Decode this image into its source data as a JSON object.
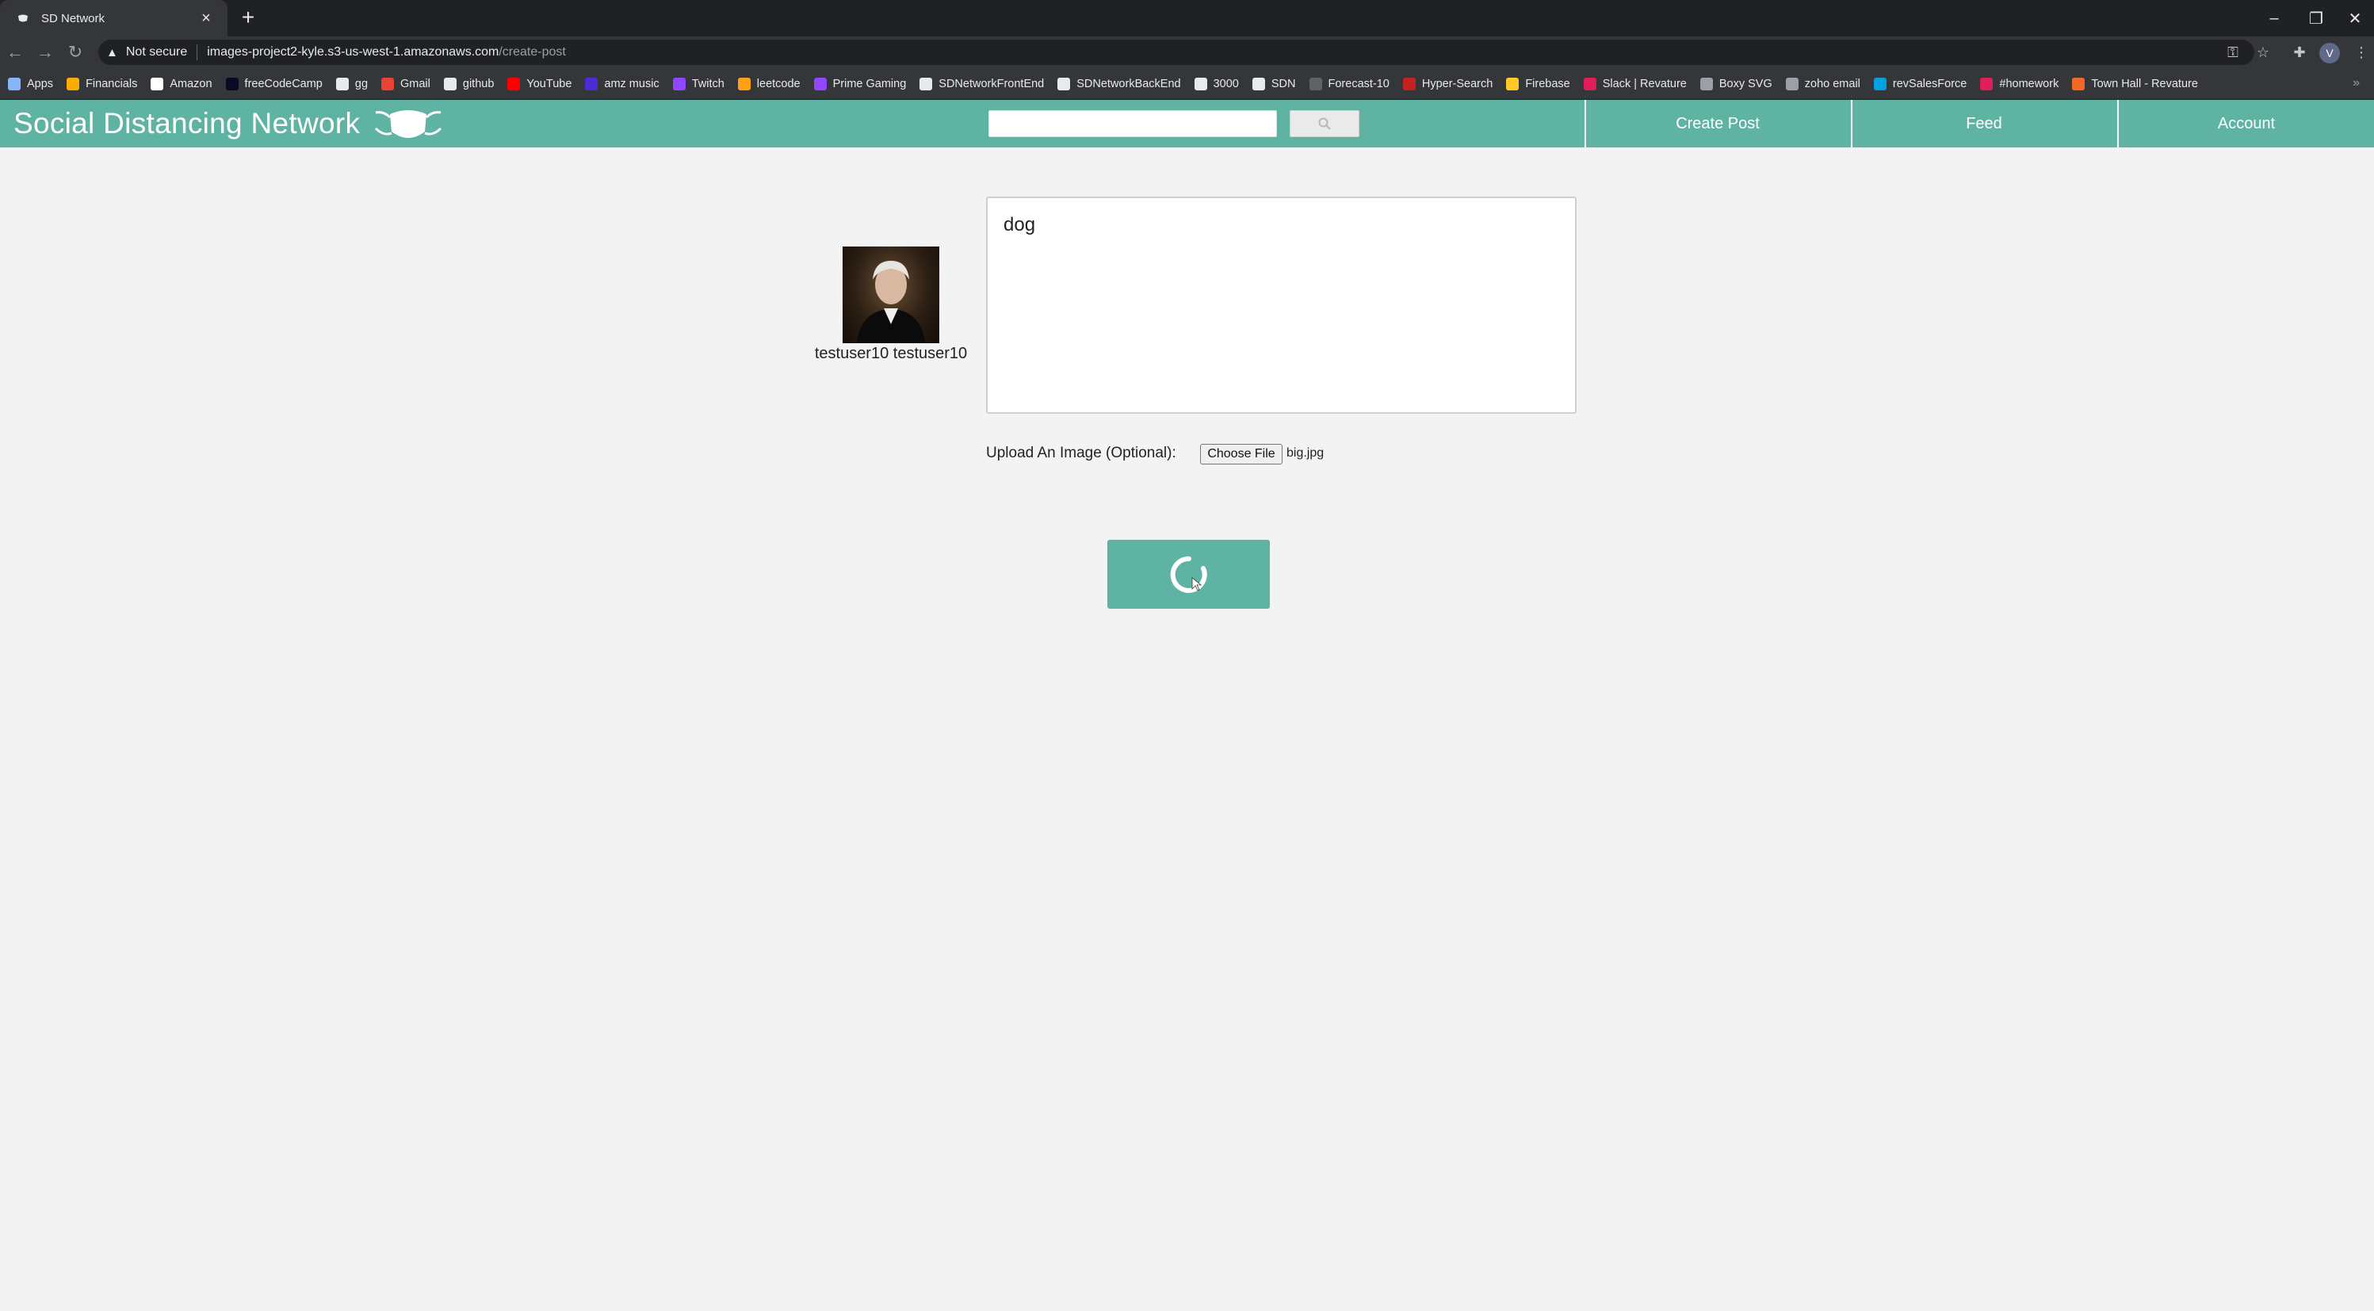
{
  "browser": {
    "tab_title": "SD Network",
    "security_label": "Not secure",
    "url_host": "images-project2-kyle.s3-us-west-1.amazonaws.com",
    "url_path": "/create-post",
    "profile_initial": "V",
    "bookmarks": [
      {
        "label": "Apps",
        "icon": "apps-grid-icon",
        "color": "#8ab4f8"
      },
      {
        "label": "Financials",
        "icon": "folder-icon",
        "color": "#f9ab00"
      },
      {
        "label": "Amazon",
        "icon": "amazon-icon",
        "color": "#ffffff"
      },
      {
        "label": "freeCodeCamp",
        "icon": "freecodecamp-icon",
        "color": "#0a0a23"
      },
      {
        "label": "gg",
        "icon": "gg-icon",
        "color": "#e8eaed"
      },
      {
        "label": "Gmail",
        "icon": "gmail-icon",
        "color": "#ea4335"
      },
      {
        "label": "github",
        "icon": "github-icon",
        "color": "#e8eaed"
      },
      {
        "label": "YouTube",
        "icon": "youtube-icon",
        "color": "#ff0000"
      },
      {
        "label": "amz music",
        "icon": "amz-music-icon",
        "color": "#4b2bd6"
      },
      {
        "label": "Twitch",
        "icon": "twitch-icon",
        "color": "#9146ff"
      },
      {
        "label": "leetcode",
        "icon": "leetcode-icon",
        "color": "#ffa116"
      },
      {
        "label": "Prime Gaming",
        "icon": "prime-gaming-icon",
        "color": "#9146ff"
      },
      {
        "label": "SDNetworkFrontEnd",
        "icon": "github-icon",
        "color": "#e8eaed"
      },
      {
        "label": "SDNetworkBackEnd",
        "icon": "github-icon",
        "color": "#e8eaed"
      },
      {
        "label": "3000",
        "icon": "globe-icon",
        "color": "#e8eaed"
      },
      {
        "label": "SDN",
        "icon": "globe-icon",
        "color": "#e8eaed"
      },
      {
        "label": "Forecast-10",
        "icon": "cloud-icon",
        "color": "#5f6368"
      },
      {
        "label": "Hyper-Search",
        "icon": "hyper-search-icon",
        "color": "#c5221f"
      },
      {
        "label": "Firebase",
        "icon": "firebase-icon",
        "color": "#ffca28"
      },
      {
        "label": "Slack | Revature",
        "icon": "slack-icon",
        "color": "#e01e5a"
      },
      {
        "label": "Boxy SVG",
        "icon": "boxy-svg-icon",
        "color": "#9aa0a6"
      },
      {
        "label": "zoho email",
        "icon": "zoho-icon",
        "color": "#9aa0a6"
      },
      {
        "label": "revSalesForce",
        "icon": "salesforce-icon",
        "color": "#00a1e0"
      },
      {
        "label": "#homework",
        "icon": "homework-icon",
        "color": "#e01e5a"
      },
      {
        "label": "Town Hall - Revature",
        "icon": "revature-icon",
        "color": "#f26925"
      }
    ]
  },
  "site": {
    "brand": "Social Distancing Network",
    "search_placeholder": "",
    "nav": [
      {
        "label": "Create Post"
      },
      {
        "label": "Feed"
      },
      {
        "label": "Account"
      }
    ],
    "accent_color": "#5fb3a3"
  },
  "post": {
    "username": "testuser10 testuser10",
    "text": "dog",
    "upload_label": "Upload An Image (Optional):",
    "choose_file_label": "Choose File",
    "file_name": "big.jpg",
    "submit_state": "loading"
  }
}
